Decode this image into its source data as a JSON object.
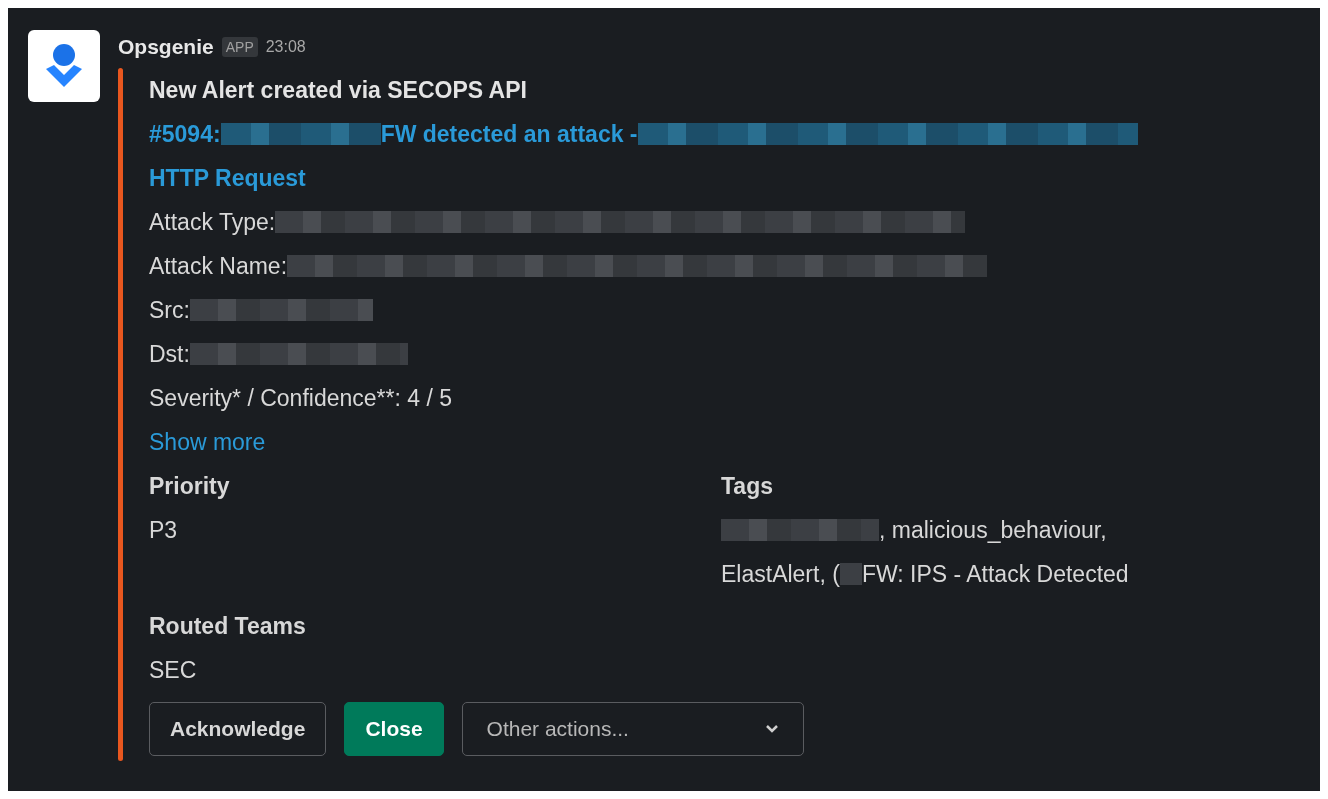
{
  "message": {
    "sender": "Opsgenie",
    "badge": "APP",
    "time": "23:08",
    "title": "New Alert created via SECOPS API",
    "alert_link": [
      [
        {
          "kind": "text",
          "text": "#5094:"
        },
        {
          "kind": "redacted"
        },
        {
          "kind": "text",
          "text": "FW detected an attack -"
        },
        {
          "kind": "redacted"
        }
      ],
      [
        {
          "kind": "text",
          "text": "HTTP Request"
        }
      ]
    ],
    "details": [
      [
        {
          "kind": "text",
          "text": "Attack Type:"
        },
        {
          "kind": "redacted"
        }
      ],
      [
        {
          "kind": "text",
          "text": "Attack Name:"
        },
        {
          "kind": "redacted"
        }
      ],
      [
        {
          "kind": "text",
          "text": "Src:"
        },
        {
          "kind": "redacted"
        }
      ],
      [
        {
          "kind": "text",
          "text": "Dst:"
        },
        {
          "kind": "redacted"
        }
      ],
      [
        {
          "kind": "text",
          "text": "Severity* / Confidence**: 4 / 5"
        }
      ]
    ],
    "show_more": "Show more",
    "fields": [
      {
        "label": "Priority",
        "lines": [
          [
            {
              "kind": "text",
              "text": "P3"
            }
          ]
        ]
      },
      {
        "label": "Tags",
        "lines": [
          [
            {
              "kind": "redacted"
            },
            {
              "kind": "text",
              "text": ", malicious_behaviour,"
            }
          ],
          [
            {
              "kind": "text",
              "text": "ElastAlert, ("
            },
            {
              "kind": "redacted"
            },
            {
              "kind": "text",
              "text": "FW: IPS - Attack Detected"
            }
          ]
        ]
      },
      {
        "label": "Routed Teams",
        "lines": [
          [
            {
              "kind": "text",
              "text": "SEC"
            }
          ]
        ]
      }
    ],
    "actions": [
      {
        "kind": "button",
        "label": "Acknowledge"
      },
      {
        "kind": "primary",
        "label": "Close"
      },
      {
        "kind": "select",
        "label": "Other actions..."
      }
    ]
  }
}
